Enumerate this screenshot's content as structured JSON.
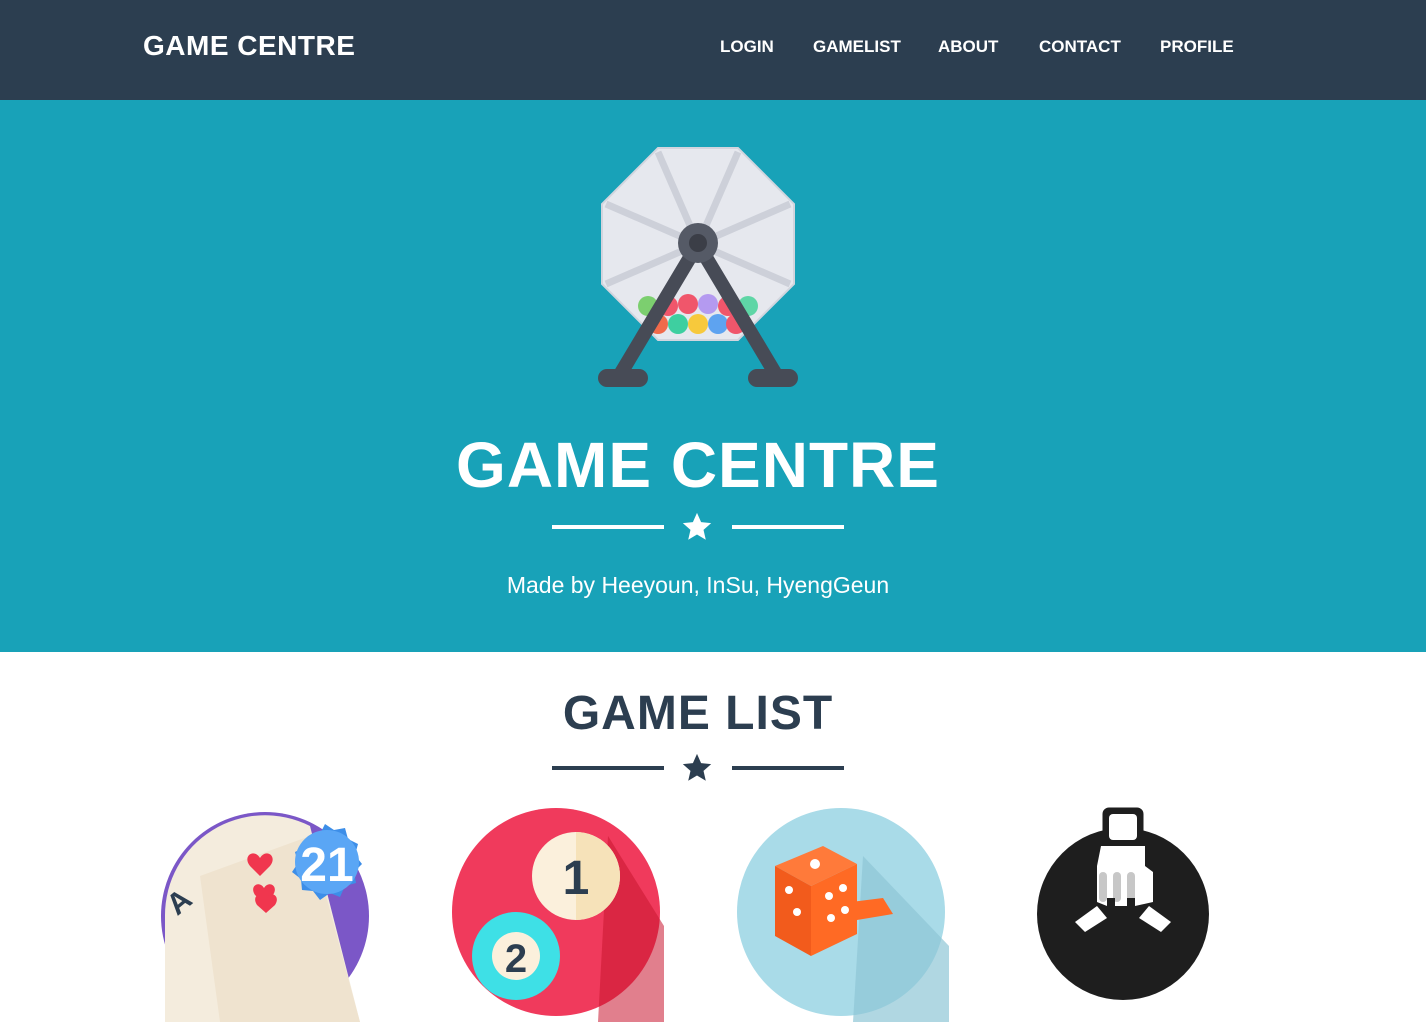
{
  "navbar": {
    "brand": "GAME CENTRE",
    "items": [
      "LOGIN",
      "GAMELIST",
      "ABOUT",
      "CONTACT",
      "PROFILE"
    ]
  },
  "hero": {
    "logo_icon": "lottery-machine-icon",
    "title": "GAME CENTRE",
    "divider_icon": "star-icon",
    "subtitle": "Made by Heeyoun, InSu, HyengGeun"
  },
  "game_list": {
    "title": "GAME LIST",
    "divider_icon": "star-icon",
    "games": [
      {
        "icon": "blackjack-cards-icon",
        "badge": "21"
      },
      {
        "icon": "billiard-balls-icon",
        "badge": "1"
      },
      {
        "icon": "dice-icon"
      },
      {
        "icon": "rock-paper-scissors-icon"
      }
    ]
  },
  "colors": {
    "navbar": "#2c3e50",
    "hero": "#18a2b8",
    "text_dark": "#2c3e50",
    "white": "#ffffff"
  }
}
